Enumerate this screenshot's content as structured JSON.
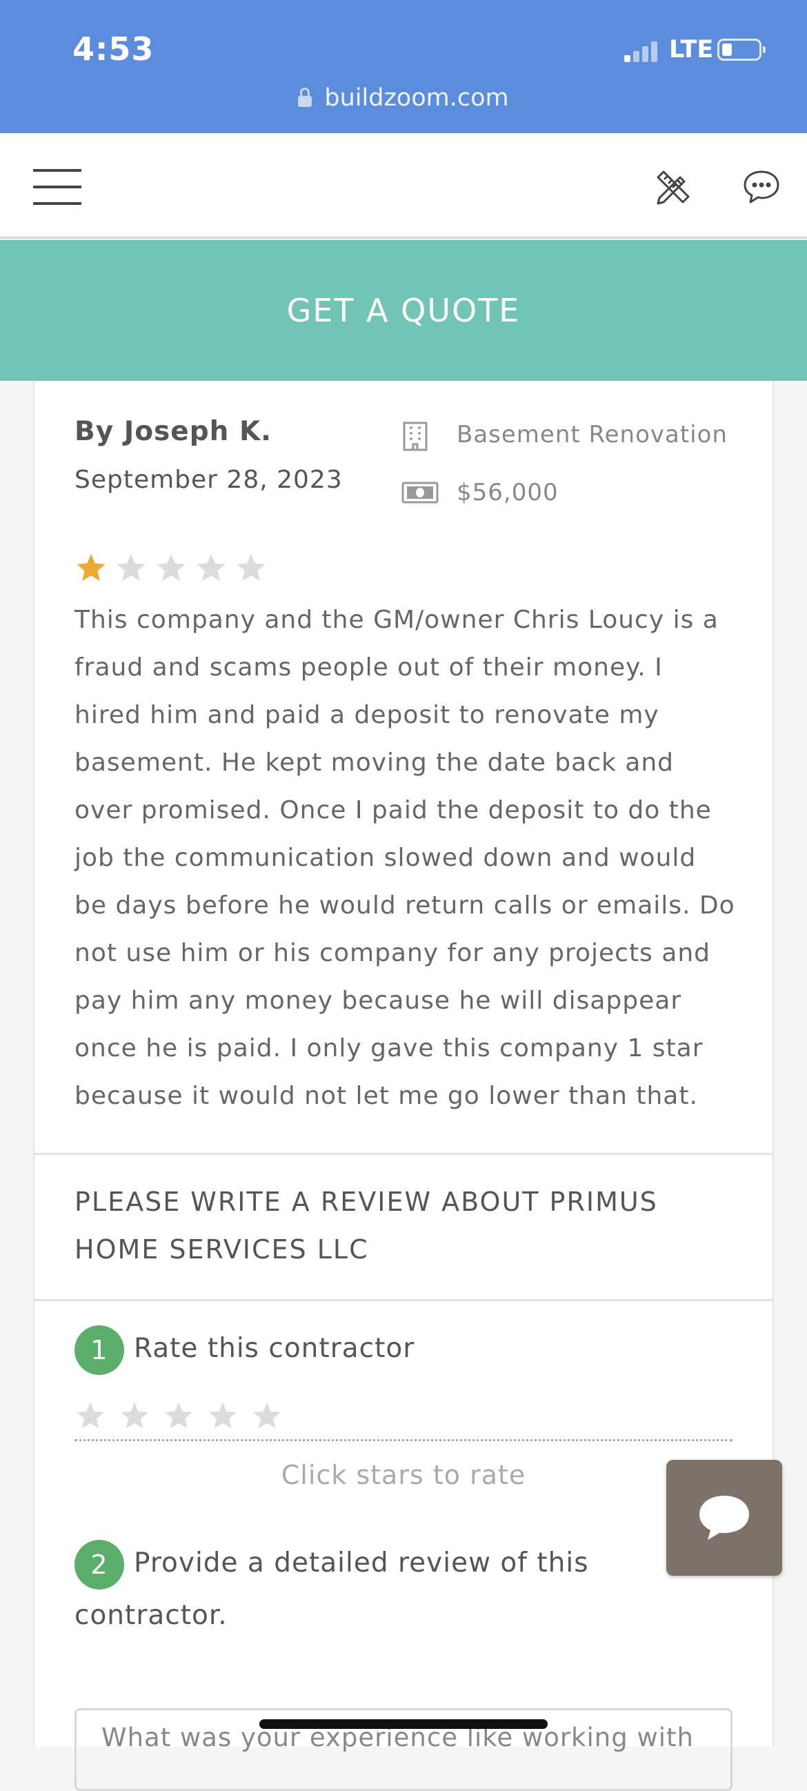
{
  "status_bar": {
    "time": "4:53",
    "network": "LTE",
    "url": "buildzoom.com"
  },
  "nav": {
    "menu_icon": "hamburger-icon",
    "tools_icon": "ruler-pencil-icon",
    "chat_icon": "speech-bubble-icon"
  },
  "cta": {
    "label": "GET A QUOTE"
  },
  "review": {
    "author": "By Joseph K.",
    "date": "September 28, 2023",
    "project_type": "Basement Renovation",
    "project_cost": "$56,000",
    "rating": 1,
    "max_rating": 5,
    "text": "This company and the GM/owner Chris Loucy is a fraud and scams people out of their money. I hired him and paid a deposit to renovate my basement. He kept moving the date back and over promised. Once I paid the deposit to do the job the communication slowed down and would be days before he would return calls or emails. Do not use him or his company for any projects and pay him any money because he will disappear once he is paid. I only gave this company 1 star because it would not let me go lower than that."
  },
  "write_review": {
    "heading": "PLEASE WRITE A REVIEW ABOUT PRIMUS HOME SERVICES LLC",
    "step1_number": "1",
    "step1_label": "Rate this contractor",
    "rating_hint": "Click stars to rate",
    "step2_number": "2",
    "step2_label": "Provide a detailed review of this contractor.",
    "textarea_placeholder": "What was your experience like working with"
  },
  "colors": {
    "status_bar": "#5b8ddc",
    "cta": "#72c4b4",
    "star_filled": "#f0a830",
    "star_empty": "#dcdcdc",
    "step_badge": "#5aae6a",
    "chat_button": "#7d7268"
  }
}
